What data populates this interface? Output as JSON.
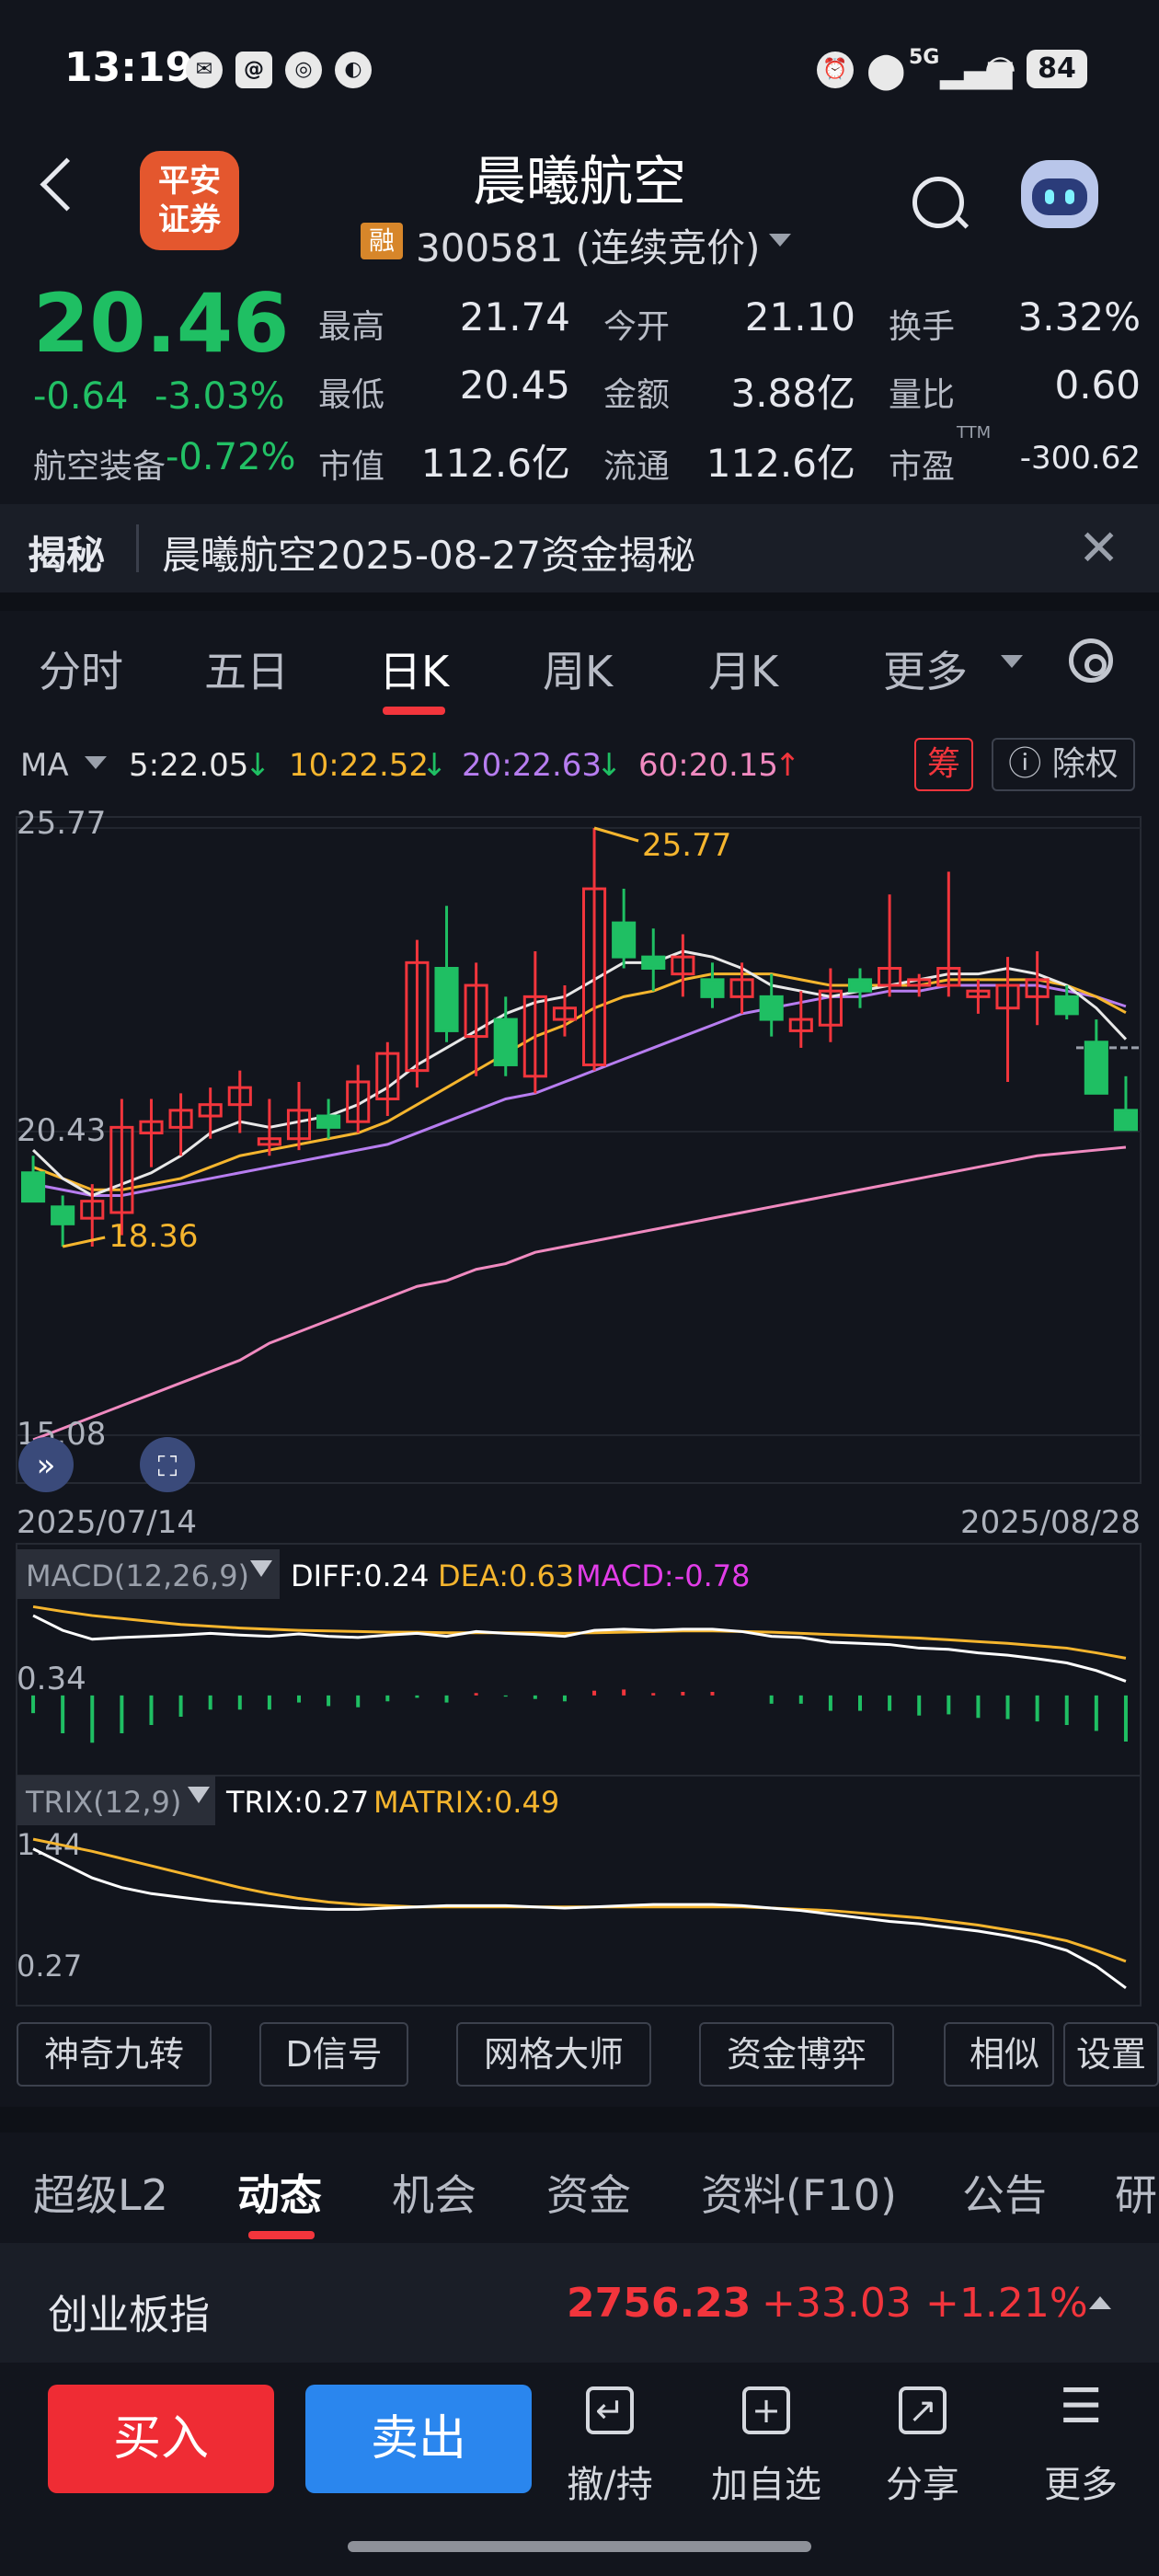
{
  "status_bar": {
    "time": "13:19",
    "network": "5G",
    "battery": "84"
  },
  "header": {
    "broker_logo": "平安证券",
    "broker_logo_line1": "平安",
    "broker_logo_line2": "证券",
    "stock_name": "晨曦航空",
    "margin_tag": "融",
    "stock_code": "300581 (连续竞价)"
  },
  "quote": {
    "price": "20.46",
    "change": "-0.64",
    "change_pct": "-3.03%",
    "sector_name": "航空装备",
    "sector_pct": "-0.72%",
    "high_label": "最高",
    "high": "21.74",
    "low_label": "最低",
    "low": "20.45",
    "mcap_label": "市值",
    "mcap": "112.6亿",
    "open_label": "今开",
    "open": "21.10",
    "amount_label": "金额",
    "amount": "3.88亿",
    "float_label": "流通",
    "float": "112.6亿",
    "turnover_label": "换手",
    "turnover": "3.32%",
    "volratio_label": "量比",
    "volratio": "0.60",
    "pe_label": "市盈",
    "pe_sup": "TTM",
    "pe": "-300.62"
  },
  "banner": {
    "tag": "揭秘",
    "message": "晨曦航空2025-08-27资金揭秘"
  },
  "period_tabs": [
    "分时",
    "五日",
    "日K",
    "周K",
    "月K",
    "更多"
  ],
  "active_period": "日K",
  "ma_legend": {
    "label": "MA",
    "ma5": "5:22.05",
    "ma10": "10:22.52",
    "ma20": "20:22.63",
    "ma60": "60:20.15",
    "chip_btn": "筹",
    "exright_btn": "除权"
  },
  "colors": {
    "up": "#f2353c",
    "down": "#1fbf63",
    "ma5": "#e8e8e8",
    "ma10": "#f5b52e",
    "ma20": "#b77df0",
    "ma60": "#f08ac0",
    "macd_diff": "#ffffff",
    "macd_dea": "#f5b52e",
    "macd_label": "#e23de8"
  },
  "chart_data": {
    "type": "candlestick",
    "ylim": [
      15.08,
      25.77
    ],
    "y_ticks": [
      "25.77",
      "20.43",
      "15.08"
    ],
    "x_start": "2025/07/14",
    "x_end": "2025/08/28",
    "high_marker": "25.77",
    "low_marker": "18.36",
    "candles": [
      {
        "o": 19.7,
        "h": 20.0,
        "l": 19.3,
        "c": 19.2
      },
      {
        "o": 19.1,
        "h": 19.3,
        "l": 18.4,
        "c": 18.8
      },
      {
        "o": 18.9,
        "h": 19.5,
        "l": 18.4,
        "c": 19.2
      },
      {
        "o": 19.0,
        "h": 21.0,
        "l": 18.6,
        "c": 20.5
      },
      {
        "o": 20.4,
        "h": 21.0,
        "l": 19.8,
        "c": 20.6
      },
      {
        "o": 20.5,
        "h": 21.1,
        "l": 20.0,
        "c": 20.8
      },
      {
        "o": 20.7,
        "h": 21.2,
        "l": 20.3,
        "c": 20.9
      },
      {
        "o": 20.9,
        "h": 21.5,
        "l": 20.4,
        "c": 21.2
      },
      {
        "o": 20.2,
        "h": 21.0,
        "l": 20.0,
        "c": 20.3
      },
      {
        "o": 20.3,
        "h": 21.3,
        "l": 20.1,
        "c": 20.8
      },
      {
        "o": 20.7,
        "h": 21.0,
        "l": 20.3,
        "c": 20.5
      },
      {
        "o": 20.6,
        "h": 21.6,
        "l": 20.4,
        "c": 21.3
      },
      {
        "o": 21.0,
        "h": 22.0,
        "l": 20.7,
        "c": 21.8
      },
      {
        "o": 21.5,
        "h": 23.8,
        "l": 21.2,
        "c": 23.4
      },
      {
        "o": 23.3,
        "h": 24.4,
        "l": 22.0,
        "c": 22.2
      },
      {
        "o": 22.1,
        "h": 23.4,
        "l": 21.4,
        "c": 23.0
      },
      {
        "o": 22.4,
        "h": 22.8,
        "l": 21.4,
        "c": 21.6
      },
      {
        "o": 21.4,
        "h": 23.6,
        "l": 21.1,
        "c": 22.8
      },
      {
        "o": 22.4,
        "h": 23.0,
        "l": 22.1,
        "c": 22.6
      },
      {
        "o": 21.6,
        "h": 25.77,
        "l": 21.5,
        "c": 24.7
      },
      {
        "o": 24.1,
        "h": 24.7,
        "l": 23.3,
        "c": 23.5
      },
      {
        "o": 23.5,
        "h": 24.0,
        "l": 22.9,
        "c": 23.3
      },
      {
        "o": 23.2,
        "h": 23.9,
        "l": 22.8,
        "c": 23.5
      },
      {
        "o": 23.1,
        "h": 23.4,
        "l": 22.6,
        "c": 22.8
      },
      {
        "o": 22.8,
        "h": 23.4,
        "l": 22.5,
        "c": 23.1
      },
      {
        "o": 22.8,
        "h": 23.2,
        "l": 22.1,
        "c": 22.4
      },
      {
        "o": 22.2,
        "h": 22.9,
        "l": 21.9,
        "c": 22.4
      },
      {
        "o": 22.3,
        "h": 23.3,
        "l": 22.0,
        "c": 22.9
      },
      {
        "o": 23.1,
        "h": 23.3,
        "l": 22.6,
        "c": 22.9
      },
      {
        "o": 23.0,
        "h": 24.6,
        "l": 22.8,
        "c": 23.3
      },
      {
        "o": 23.0,
        "h": 23.2,
        "l": 22.8,
        "c": 23.1
      },
      {
        "o": 23.0,
        "h": 25.0,
        "l": 22.8,
        "c": 23.3
      },
      {
        "o": 22.8,
        "h": 23.1,
        "l": 22.5,
        "c": 22.9
      },
      {
        "o": 22.6,
        "h": 23.5,
        "l": 21.3,
        "c": 23.0
      },
      {
        "o": 22.8,
        "h": 23.6,
        "l": 22.3,
        "c": 23.1
      },
      {
        "o": 22.8,
        "h": 23.0,
        "l": 22.4,
        "c": 22.5
      },
      {
        "o": 22.0,
        "h": 22.4,
        "l": 21.1,
        "c": 21.1
      },
      {
        "o": 20.8,
        "h": 21.4,
        "l": 20.45,
        "c": 20.46
      }
    ],
    "ma5": [
      20.1,
      19.6,
      19.3,
      19.5,
      19.7,
      20.0,
      20.4,
      20.6,
      20.5,
      20.6,
      20.7,
      20.9,
      21.2,
      21.6,
      21.9,
      22.2,
      22.5,
      22.7,
      22.8,
      23.1,
      23.4,
      23.4,
      23.6,
      23.5,
      23.3,
      23.0,
      22.9,
      22.8,
      22.9,
      23.0,
      23.1,
      23.2,
      23.2,
      23.3,
      23.2,
      23.0,
      22.6,
      22.05
    ],
    "ma10": [
      19.8,
      19.6,
      19.4,
      19.4,
      19.5,
      19.6,
      19.8,
      20.0,
      20.1,
      20.2,
      20.3,
      20.4,
      20.6,
      20.9,
      21.2,
      21.5,
      21.8,
      22.1,
      22.3,
      22.6,
      22.8,
      22.9,
      23.1,
      23.2,
      23.2,
      23.2,
      23.1,
      23.0,
      23.0,
      23.0,
      23.0,
      23.1,
      23.1,
      23.1,
      23.1,
      23.0,
      22.8,
      22.52
    ],
    "ma20": [
      19.5,
      19.4,
      19.3,
      19.3,
      19.4,
      19.5,
      19.6,
      19.7,
      19.8,
      19.9,
      20.0,
      20.1,
      20.2,
      20.4,
      20.6,
      20.8,
      21.0,
      21.1,
      21.3,
      21.5,
      21.7,
      21.9,
      22.1,
      22.3,
      22.5,
      22.6,
      22.7,
      22.8,
      22.8,
      22.9,
      22.9,
      23.0,
      23.0,
      23.0,
      23.0,
      22.9,
      22.8,
      22.63
    ],
    "ma60": [
      15.0,
      15.2,
      15.4,
      15.6,
      15.8,
      16.0,
      16.2,
      16.4,
      16.7,
      16.9,
      17.1,
      17.3,
      17.5,
      17.7,
      17.8,
      18.0,
      18.1,
      18.3,
      18.4,
      18.5,
      18.6,
      18.7,
      18.8,
      18.9,
      19.0,
      19.1,
      19.2,
      19.3,
      19.4,
      19.5,
      19.6,
      19.7,
      19.8,
      19.9,
      20.0,
      20.05,
      20.1,
      20.15
    ]
  },
  "macd": {
    "label": "MACD(12,26,9)",
    "diff_label": "DIFF:0.24",
    "dea_label": "DEA:0.63",
    "macd_label": "MACD:-0.78",
    "tick": "0.34",
    "diff": [
      1.35,
      1.1,
      0.95,
      0.98,
      1.0,
      1.02,
      1.05,
      1.02,
      1.0,
      1.04,
      1.0,
      0.98,
      1.02,
      1.05,
      1.0,
      1.08,
      1.05,
      1.03,
      1.0,
      1.1,
      1.12,
      1.1,
      1.12,
      1.12,
      1.08,
      1.0,
      0.98,
      0.9,
      0.88,
      0.86,
      0.8,
      0.78,
      0.72,
      0.68,
      0.62,
      0.55,
      0.42,
      0.24
    ],
    "dea": [
      1.5,
      1.42,
      1.35,
      1.3,
      1.25,
      1.2,
      1.17,
      1.14,
      1.12,
      1.1,
      1.09,
      1.08,
      1.07,
      1.07,
      1.06,
      1.06,
      1.06,
      1.06,
      1.05,
      1.06,
      1.07,
      1.08,
      1.09,
      1.09,
      1.08,
      1.07,
      1.05,
      1.03,
      1.01,
      0.99,
      0.97,
      0.94,
      0.91,
      0.88,
      0.84,
      0.8,
      0.72,
      0.63
    ],
    "hist": [
      -0.3,
      -0.64,
      -0.8,
      -0.64,
      -0.5,
      -0.36,
      -0.24,
      -0.24,
      -0.24,
      -0.12,
      -0.18,
      -0.2,
      -0.1,
      -0.04,
      -0.12,
      0.04,
      -0.02,
      -0.06,
      -0.1,
      0.08,
      0.1,
      0.04,
      0.06,
      0.06,
      0.0,
      -0.14,
      -0.14,
      -0.26,
      -0.26,
      -0.26,
      -0.34,
      -0.32,
      -0.38,
      -0.4,
      -0.44,
      -0.5,
      -0.6,
      -0.78
    ],
    "ylim": [
      -1.2,
      1.6
    ]
  },
  "trix": {
    "label": "TRIX(12,9)",
    "trix_label": "TRIX:0.27",
    "matrix_label": "MATRIX:0.49",
    "tick_top": "1.44",
    "tick_bottom": "0.27",
    "trix": [
      1.42,
      1.3,
      1.18,
      1.1,
      1.05,
      1.02,
      0.99,
      0.97,
      0.95,
      0.93,
      0.92,
      0.92,
      0.93,
      0.94,
      0.95,
      0.95,
      0.95,
      0.94,
      0.93,
      0.94,
      0.95,
      0.96,
      0.96,
      0.96,
      0.95,
      0.93,
      0.91,
      0.88,
      0.85,
      0.82,
      0.8,
      0.77,
      0.74,
      0.7,
      0.65,
      0.58,
      0.45,
      0.27
    ],
    "matrix": [
      1.5,
      1.45,
      1.4,
      1.34,
      1.28,
      1.22,
      1.16,
      1.1,
      1.05,
      1.01,
      0.98,
      0.96,
      0.95,
      0.94,
      0.94,
      0.94,
      0.94,
      0.94,
      0.94,
      0.94,
      0.94,
      0.94,
      0.94,
      0.94,
      0.94,
      0.93,
      0.92,
      0.91,
      0.89,
      0.87,
      0.85,
      0.82,
      0.79,
      0.75,
      0.71,
      0.66,
      0.58,
      0.49
    ],
    "ylim": [
      0.2,
      1.6
    ]
  },
  "feature_buttons": [
    "神奇九转",
    "D信号",
    "网格大师",
    "资金博弈",
    "相似K",
    "设置"
  ],
  "section_tabs": [
    "超级L2",
    "动态",
    "机会",
    "资金",
    "资料(F10)",
    "公告",
    "研"
  ],
  "active_section": "动态",
  "index_row": {
    "name": "创业板指",
    "value": "2756.23",
    "change": "+33.03",
    "pct": "+1.21%"
  },
  "bottom_bar": {
    "buy": "买入",
    "sell": "卖出",
    "cancel": "撤/持",
    "watch": "加自选",
    "share": "分享",
    "more": "更多"
  }
}
